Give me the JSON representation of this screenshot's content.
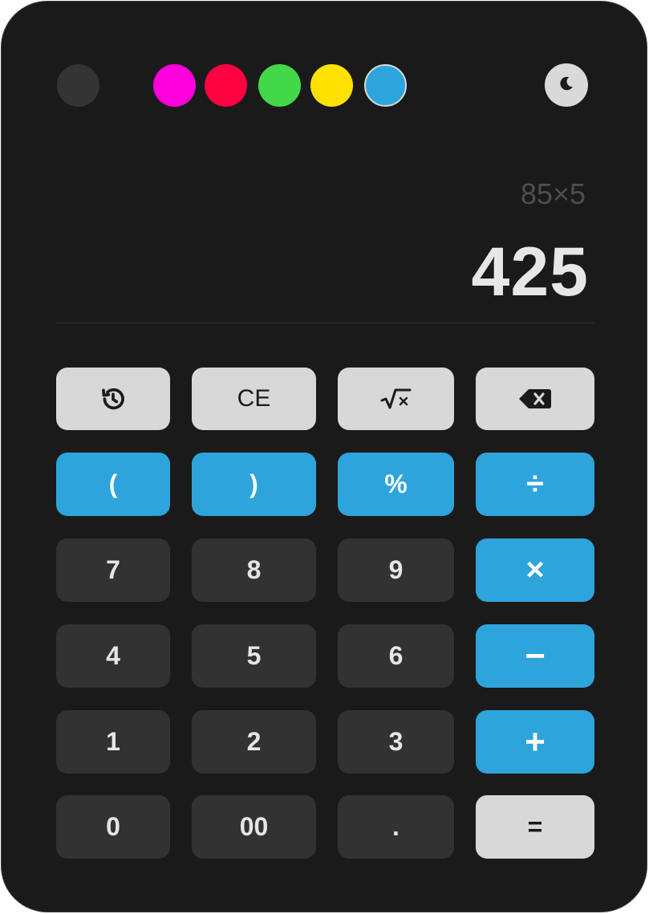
{
  "colors": {
    "background": "#1a1a1a",
    "accent": "#2ea4dc",
    "key_dark": "#323232",
    "key_light": "#d8d8d8"
  },
  "color_swatches": [
    {
      "name": "dark",
      "color": "#343434"
    },
    {
      "name": "magenta",
      "color": "#ff00dd"
    },
    {
      "name": "red",
      "color": "#ff0040"
    },
    {
      "name": "green",
      "color": "#43d84a"
    },
    {
      "name": "yellow",
      "color": "#ffe100"
    },
    {
      "name": "blue",
      "color": "#2ea4dc",
      "selected": true
    }
  ],
  "theme_toggle_icon": "moon-icon",
  "display": {
    "expression": "85×5",
    "result": "425"
  },
  "keys": {
    "history_icon": "history-icon",
    "clear_entry": "CE",
    "sqrt_icon": "square-root-icon",
    "backspace_icon": "backspace-icon",
    "open_paren": "(",
    "close_paren": ")",
    "percent": "%",
    "divide": "÷",
    "seven": "7",
    "eight": "8",
    "nine": "9",
    "multiply": "×",
    "four": "4",
    "five": "5",
    "six": "6",
    "minus": "−",
    "one": "1",
    "two": "2",
    "three": "3",
    "plus": "+",
    "zero": "0",
    "double_zero": "00",
    "decimal": ".",
    "equals": "="
  }
}
